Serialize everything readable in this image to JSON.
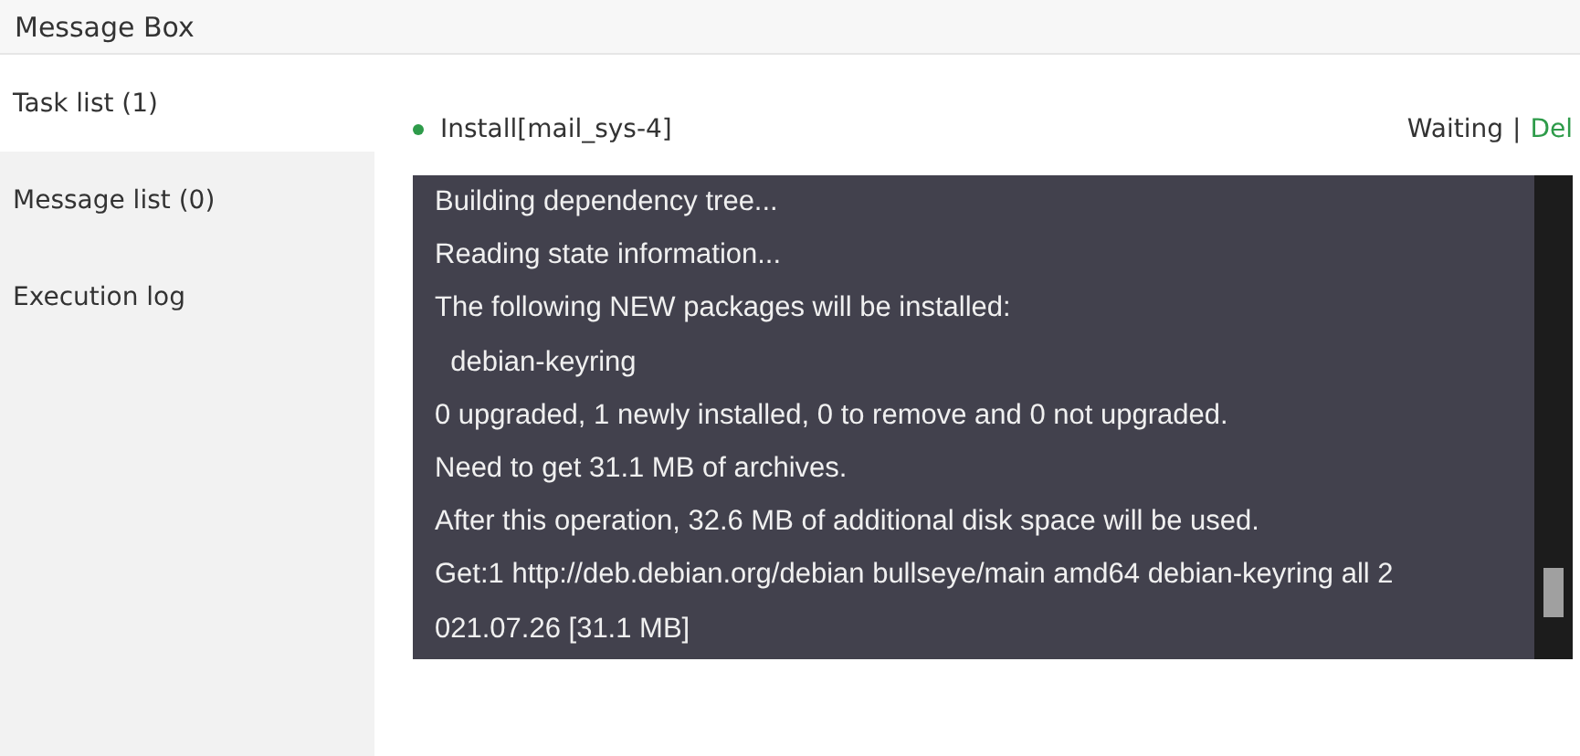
{
  "window": {
    "title": "Message Box"
  },
  "sidebar": {
    "items": [
      {
        "label": "Task list (1)",
        "selected": true
      },
      {
        "label": "Message list (0)",
        "selected": false
      },
      {
        "label": "Execution log",
        "selected": false
      }
    ]
  },
  "task": {
    "name": "Install[mail_sys-4]",
    "color": "#2e9b4a",
    "status": "Waiting",
    "separator": "|",
    "action": "Del"
  },
  "log": {
    "lines": [
      "Building dependency tree...",
      "Reading state information...",
      "The following NEW packages will be installed:",
      "  debian-keyring",
      "0 upgraded, 1 newly installed, 0 to remove and 0 not upgraded.",
      "Need to get 31.1 MB of archives.",
      "After this operation, 32.6 MB of additional disk space will be used.",
      "Get:1 http://deb.debian.org/debian bullseye/main amd64 debian-keyring all 2",
      "021.07.26 [31.1 MB]"
    ]
  }
}
